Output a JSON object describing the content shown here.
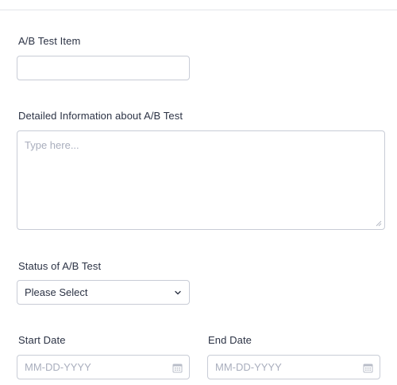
{
  "form": {
    "ab_test_item": {
      "label": "A/B Test Item",
      "value": ""
    },
    "details": {
      "label": "Detailed Information about A/B Test",
      "placeholder": "Type here..."
    },
    "status": {
      "label": "Status of A/B Test",
      "selected": "Please Select",
      "icon": "chevron-down-icon"
    },
    "start_date": {
      "label": "Start Date",
      "placeholder": "MM-DD-YYYY",
      "icon": "calendar-icon"
    },
    "end_date": {
      "label": "End Date",
      "placeholder": "MM-DD-YYYY",
      "icon": "calendar-icon"
    }
  },
  "colors": {
    "border": "#c8ccd6",
    "label_text": "#2c3345",
    "placeholder_text": "#a9aebd",
    "divider": "#e3e5ea"
  }
}
